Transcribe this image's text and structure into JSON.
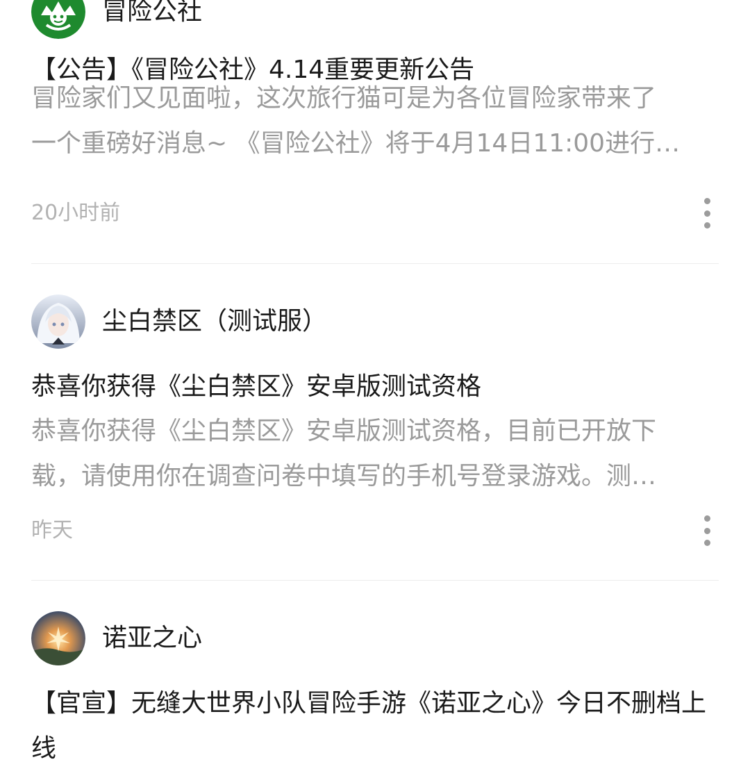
{
  "feed": {
    "posts": [
      {
        "account_name": "冒险公社",
        "title": "【公告】《冒险公社》4.14重要更新公告",
        "excerpt_lines": [
          "冒险家们又见面啦，这次旅行猫可是为各位冒险家带来了",
          "一个重磅好消息~  《冒险公社》将于4月14日11:00进行…"
        ],
        "time": "20小时前",
        "avatar_icon": "adventure-guild-logo",
        "avatar_color": "#1e8a2e"
      },
      {
        "account_name": "尘白禁区（测试服）",
        "title": "恭喜你获得《尘白禁区》安卓版测试资格",
        "excerpt_lines": [
          "恭喜你获得《尘白禁区》安卓版测试资格，目前已开放下",
          "载，请使用你在调查问卷中填写的手机号登录游戏。测…"
        ],
        "time": "昨天",
        "avatar_icon": "white-haired-character-avatar",
        "avatar_color": "#c9d4e6"
      },
      {
        "account_name": "诺亚之心",
        "title": "【官宣】无缝大世界小队冒险手游《诺亚之心》今日不删档上线",
        "avatar_icon": "noah-heart-art-avatar",
        "avatar_color": "#2d4a7a"
      }
    ]
  }
}
